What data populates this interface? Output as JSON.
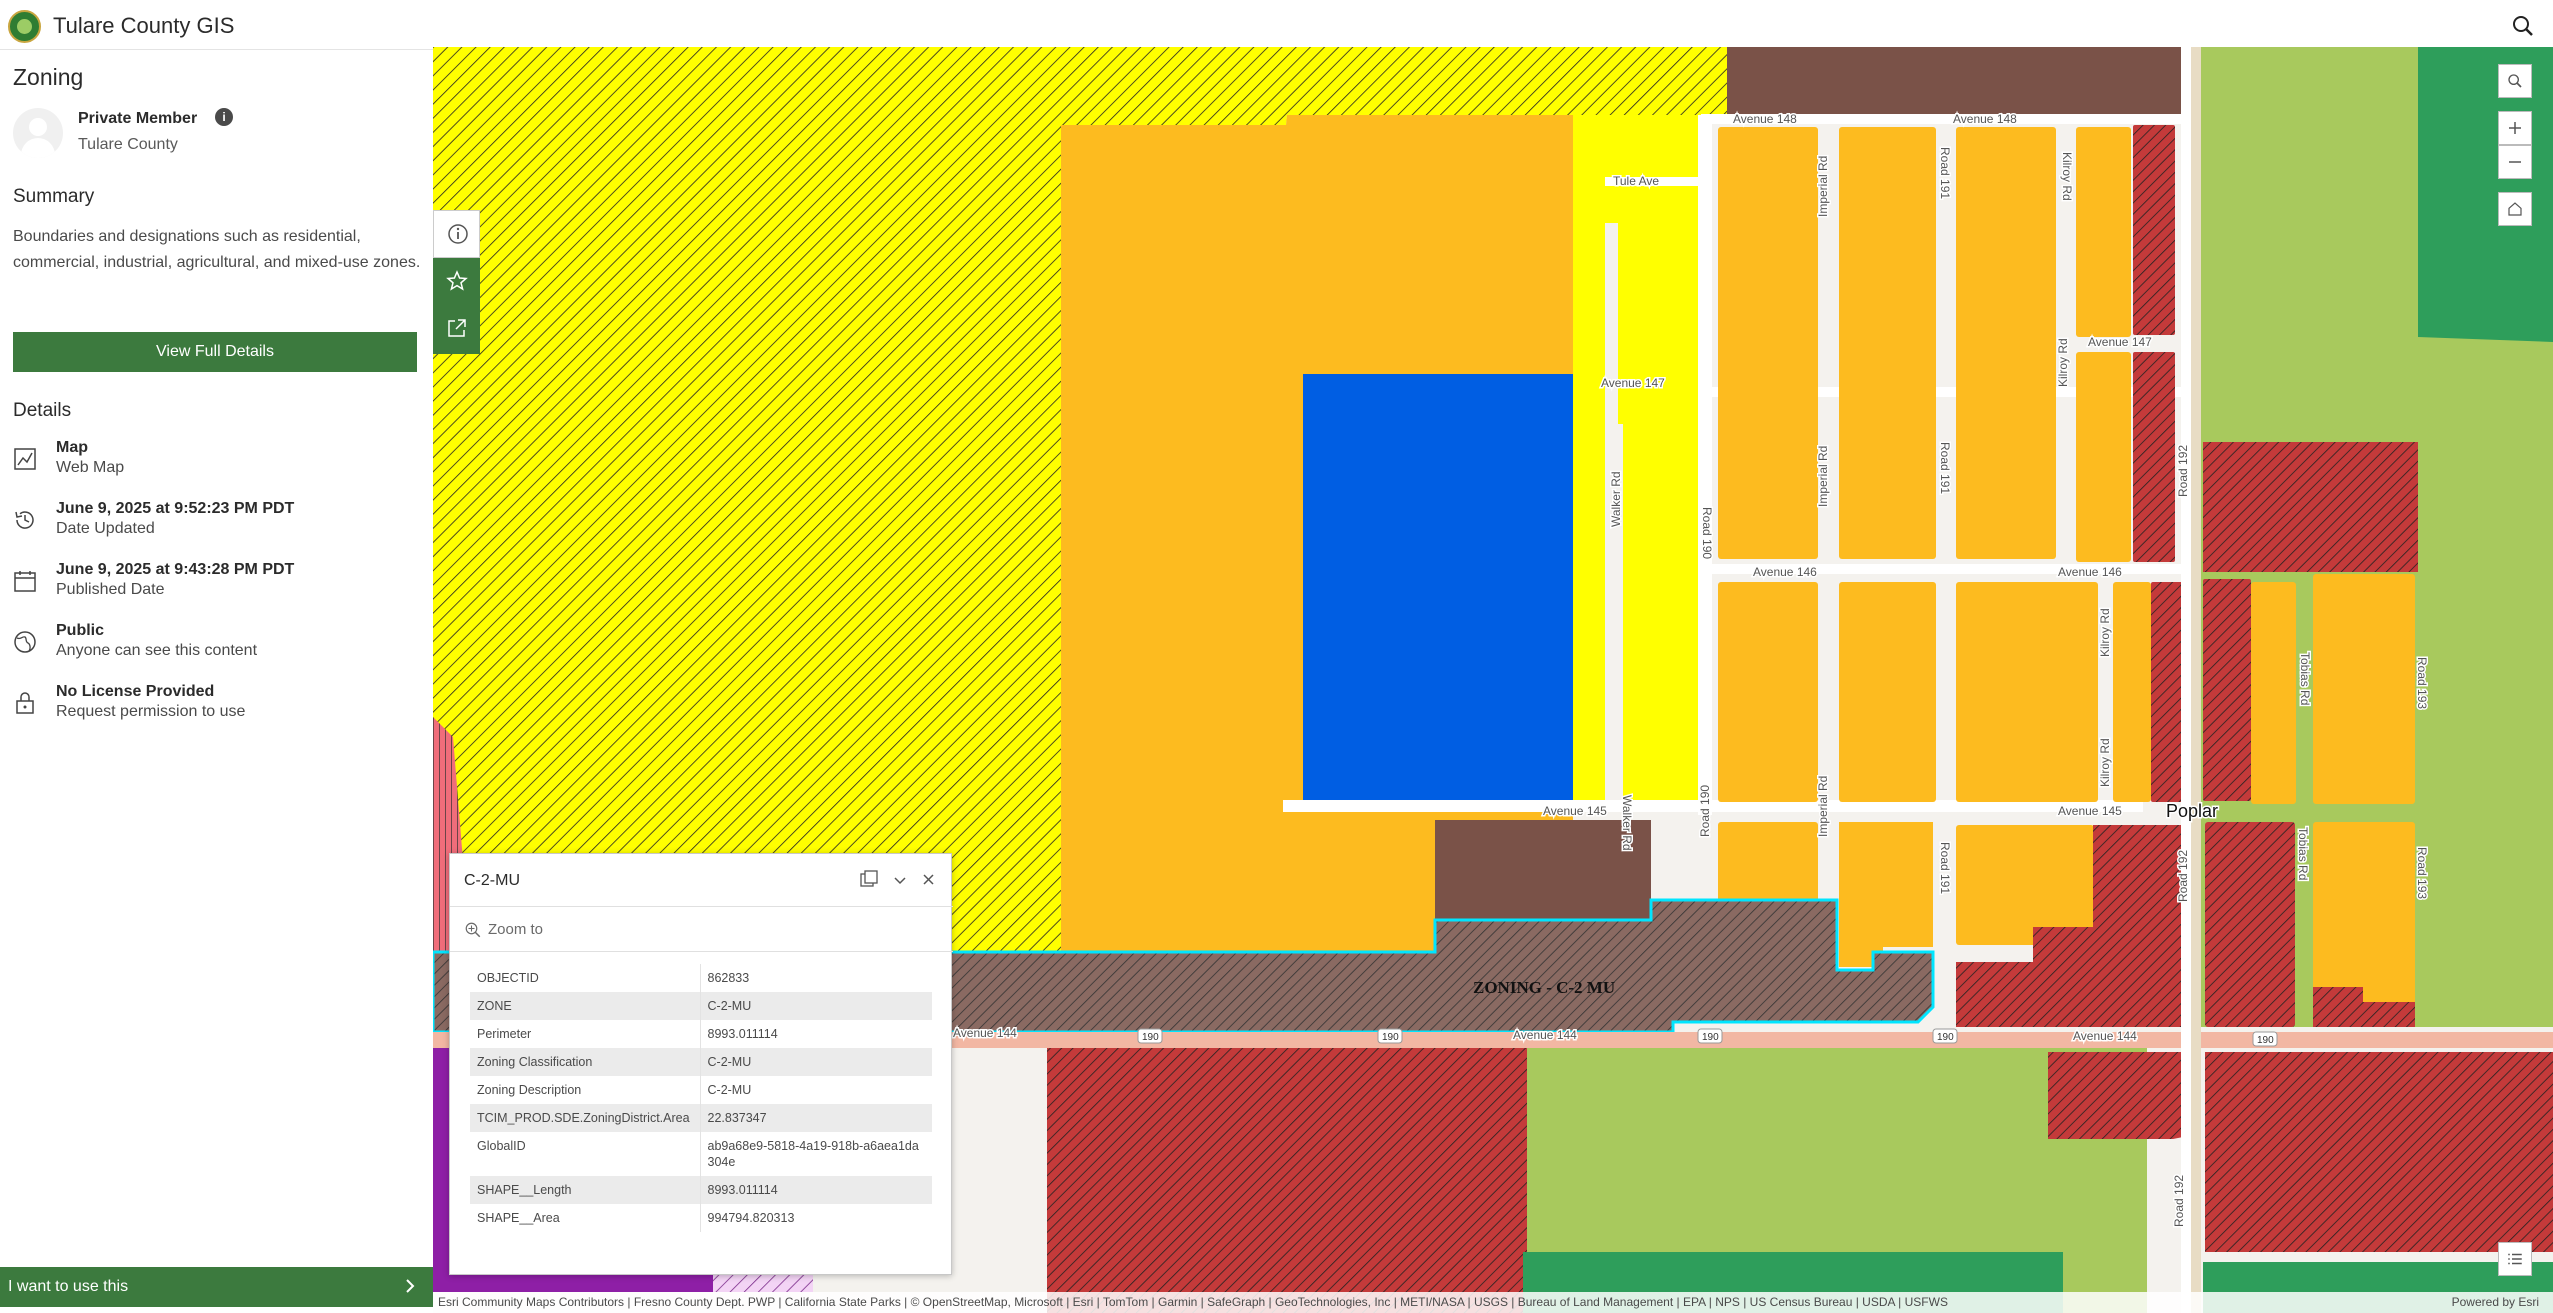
{
  "app": {
    "title": "Tulare County GIS"
  },
  "item": {
    "title": "Zoning",
    "owner": "Private Member",
    "org": "Tulare County",
    "summary_heading": "Summary",
    "summary": "Boundaries and designations such as residential, commercial, industrial, agricultural, and mixed-use zones.",
    "view_button": "View Full Details",
    "details_heading": "Details",
    "details": [
      {
        "icon": "map-icon",
        "title": "Map",
        "sub": "Web Map"
      },
      {
        "icon": "history-icon",
        "title": "June 9, 2025 at 9:52:23 PM PDT",
        "sub": "Date Updated"
      },
      {
        "icon": "calendar-icon",
        "title": "June 9, 2025 at 9:43:28 PM PDT",
        "sub": "Published Date"
      },
      {
        "icon": "globe-icon",
        "title": "Public",
        "sub": "Anyone can see this content"
      },
      {
        "icon": "lock-icon",
        "title": "No License Provided",
        "sub": "Request permission to use"
      }
    ],
    "i_want": "I want to use this"
  },
  "popup": {
    "title": "C-2-MU",
    "zoom_to": "Zoom to",
    "fields": [
      {
        "key": "OBJECTID",
        "value": "862833"
      },
      {
        "key": "ZONE",
        "value": "C-2-MU"
      },
      {
        "key": "Perimeter",
        "value": "8993.011114"
      },
      {
        "key": "Zoning Classification",
        "value": "C-2-MU"
      },
      {
        "key": "Zoning Description",
        "value": "C-2-MU"
      },
      {
        "key": "TCIM_PROD.SDE.ZoningDistrict.Area",
        "value": "22.837347"
      },
      {
        "key": "GlobalID",
        "value": "ab9a68e9-5818-4a19-918b-a6aea1da304e"
      },
      {
        "key": "SHAPE__Length",
        "value": "8993.011114"
      },
      {
        "key": "SHAPE__Area",
        "value": "994794.820313"
      }
    ]
  },
  "map": {
    "zone_label": "ZONING - C-2 MU",
    "place_label": "Poplar",
    "streets": {
      "avenue_148": "Avenue 148",
      "avenue_147": "Avenue 147",
      "avenue_146": "Avenue 146",
      "avenue_145": "Avenue 145",
      "avenue_144": "Avenue 144",
      "tule_ave": "Tule Ave",
      "walker_rd": "Walker Rd",
      "road_190": "Road 190",
      "imperial_rd": "Imperial Rd",
      "road_191": "Road 191",
      "kilroy_rd": "Kilroy Rd",
      "road_192": "Road 192",
      "tobias_rd": "Tobias Rd",
      "road_193": "Road 193",
      "hwy_190": "190"
    },
    "colors": {
      "commercial_orange": "#fdbb1f",
      "yellow": "#ffff00",
      "blue": "#005ee3",
      "brown": "#7a5248",
      "red": "#c43a3a",
      "green": "#a8c95d",
      "dark_green": "#2e9e5b",
      "highway": "#f2b7a3",
      "selection": "#00e5ff"
    }
  },
  "attribution": {
    "text": "Esri Community Maps Contributors | Fresno County Dept. PWP | California State Parks | © OpenStreetMap, Microsoft | Esri | TomTom | Garmin | SafeGraph | GeoTechnologies, Inc | METI/NASA | USGS | Bureau of Land Management | EPA | NPS | US Census Bureau | USDA | USFWS",
    "powered": "Powered by Esri"
  }
}
